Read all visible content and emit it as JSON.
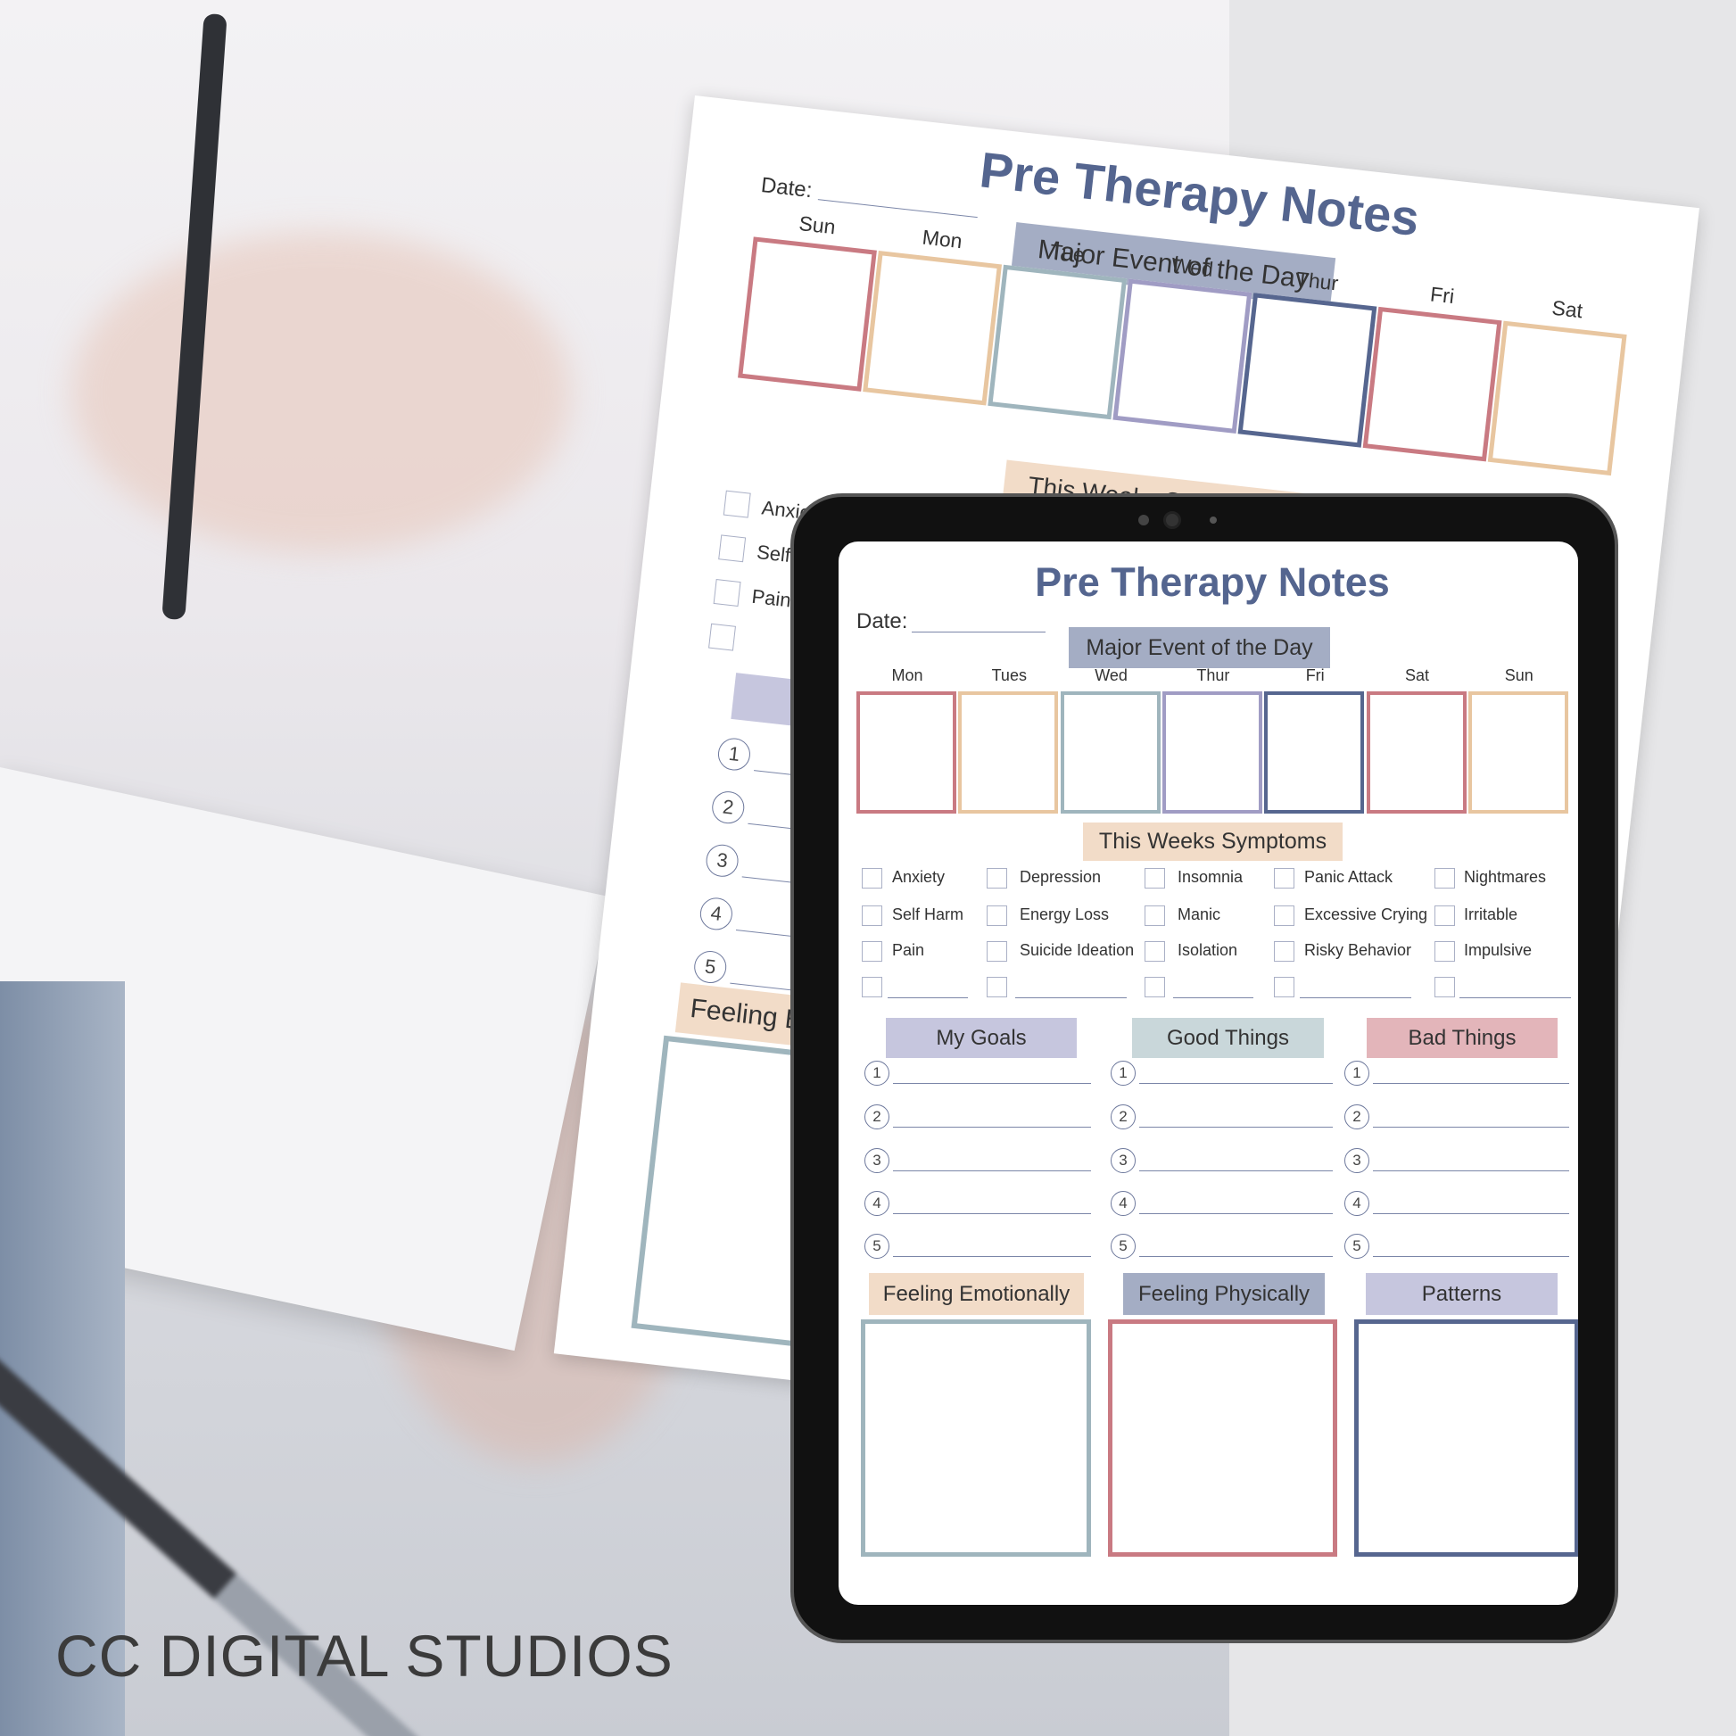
{
  "brand": "CC DIGITAL STUDIOS",
  "colors": {
    "title": "#54658f",
    "rose": "#c97a82",
    "sand": "#e8c6a0",
    "sage": "#9fb5bd",
    "lavender": "#a09cc4",
    "navy": "#56668f",
    "banner_blue": "#a4adc4",
    "banner_sand": "#f2dcc8",
    "banner_lilac": "#c6c6de",
    "banner_mint": "#c9d7da",
    "banner_pink": "#e3b5ba"
  },
  "back_page": {
    "title": "Pre Therapy Notes",
    "date_label": "Date:",
    "major_event": "Major Event of the Day",
    "days": [
      "Sun",
      "Mon",
      "Tue",
      "Wed",
      "Thur",
      "Fri",
      "Sat"
    ],
    "symptoms_header": "This Weeks Symptoms",
    "symptoms": [
      "Anxiety",
      "Self Harm",
      "Pain",
      ""
    ],
    "numbers": [
      "1",
      "2",
      "3",
      "4",
      "5"
    ],
    "feeling_header": "Feeling Emotionally"
  },
  "tablet": {
    "title": "Pre Therapy Notes",
    "date_label": "Date:",
    "major_event": "Major Event of the Day",
    "days": [
      "Mon",
      "Tues",
      "Wed",
      "Thur",
      "Fri",
      "Sat",
      "Sun"
    ],
    "symptoms_header": "This Weeks Symptoms",
    "symptom_columns": [
      [
        "Anxiety",
        "Self Harm",
        "Pain",
        ""
      ],
      [
        "Depression",
        "Energy Loss",
        "Suicide Ideation",
        ""
      ],
      [
        "Insomnia",
        "Manic",
        "Isolation",
        ""
      ],
      [
        "Panic Attack",
        "Excessive Crying",
        "Risky Behavior",
        ""
      ],
      [
        "Nightmares",
        "Irritable",
        "Impulsive",
        ""
      ]
    ],
    "lists": [
      {
        "title": "My Goals"
      },
      {
        "title": "Good Things"
      },
      {
        "title": "Bad Things"
      }
    ],
    "numbers": [
      "1",
      "2",
      "3",
      "4",
      "5"
    ],
    "bottom": [
      {
        "title": "Feeling Emotionally"
      },
      {
        "title": "Feeling Physically"
      },
      {
        "title": "Patterns"
      }
    ]
  }
}
